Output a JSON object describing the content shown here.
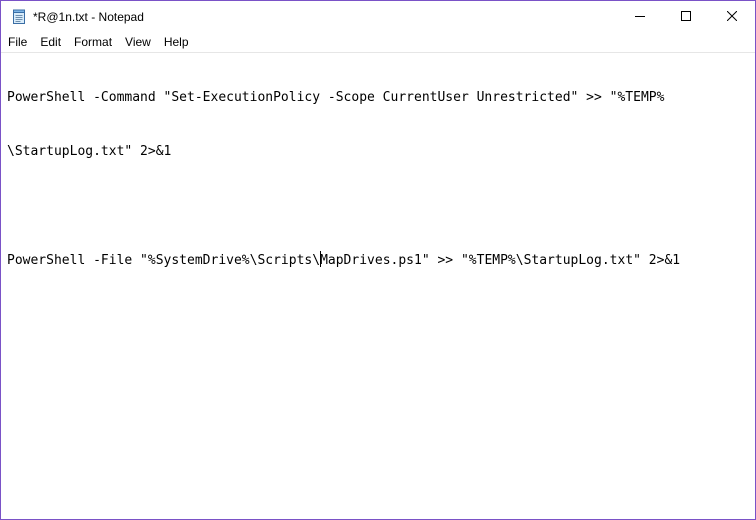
{
  "window": {
    "title": "*R@1n.txt - Notepad"
  },
  "icons": {
    "app": "notepad-icon",
    "minimize": "minimize-icon",
    "maximize": "maximize-icon",
    "close": "close-icon"
  },
  "menu": {
    "items": [
      {
        "label": "File"
      },
      {
        "label": "Edit"
      },
      {
        "label": "Format"
      },
      {
        "label": "View"
      },
      {
        "label": "Help"
      }
    ]
  },
  "editor": {
    "lines": [
      "PowerShell -Command \"Set-ExecutionPolicy -Scope CurrentUser Unrestricted\" >> \"%TEMP%",
      "\\StartupLog.txt\" 2>&1",
      "",
      "PowerShell -File \"%SystemDrive%\\Scripts\\MapDrives.ps1\" >> \"%TEMP%\\StartupLog.txt\" 2>&1"
    ],
    "caret_line": 3,
    "caret_split": {
      "before": "PowerShell -File \"%SystemDrive%\\Scripts\\",
      "after": "MapDrives.ps1\" >> \"%TEMP%\\StartupLog.txt\" 2>&1"
    }
  },
  "colors": {
    "window_border": "#7a52c7",
    "background": "#ffffff",
    "text": "#000000"
  }
}
